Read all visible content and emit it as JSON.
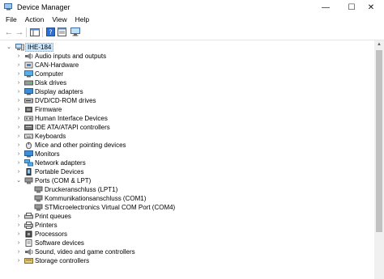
{
  "window": {
    "title": "Device Manager"
  },
  "window_controls": {
    "minimize": "—",
    "maximize": "☐",
    "close": "✕"
  },
  "menu": [
    "File",
    "Action",
    "View",
    "Help"
  ],
  "toolbar": {
    "back": "←",
    "forward": "→"
  },
  "tree": {
    "root": "IHE-184",
    "items": [
      "Audio inputs and outputs",
      "CAN-Hardware",
      "Computer",
      "Disk drives",
      "Display adapters",
      "DVD/CD-ROM drives",
      "Firmware",
      "Human Interface Devices",
      "IDE ATA/ATAPI controllers",
      "Keyboards",
      "Mice and other pointing devices",
      "Monitors",
      "Network adapters",
      "Portable Devices",
      "Ports (COM & LPT)",
      "Print queues",
      "Printers",
      "Processors",
      "Software devices",
      "Sound, video and game controllers",
      "Storage controllers"
    ],
    "ports_children": [
      "Druckeranschluss (LPT1)",
      "Kommunikationsanschluss (COM1)",
      "STMicroelectronics Virtual COM Port (COM4)"
    ]
  },
  "colors": {
    "selection": "#cce8ff",
    "accent": "#3a7bd5"
  }
}
